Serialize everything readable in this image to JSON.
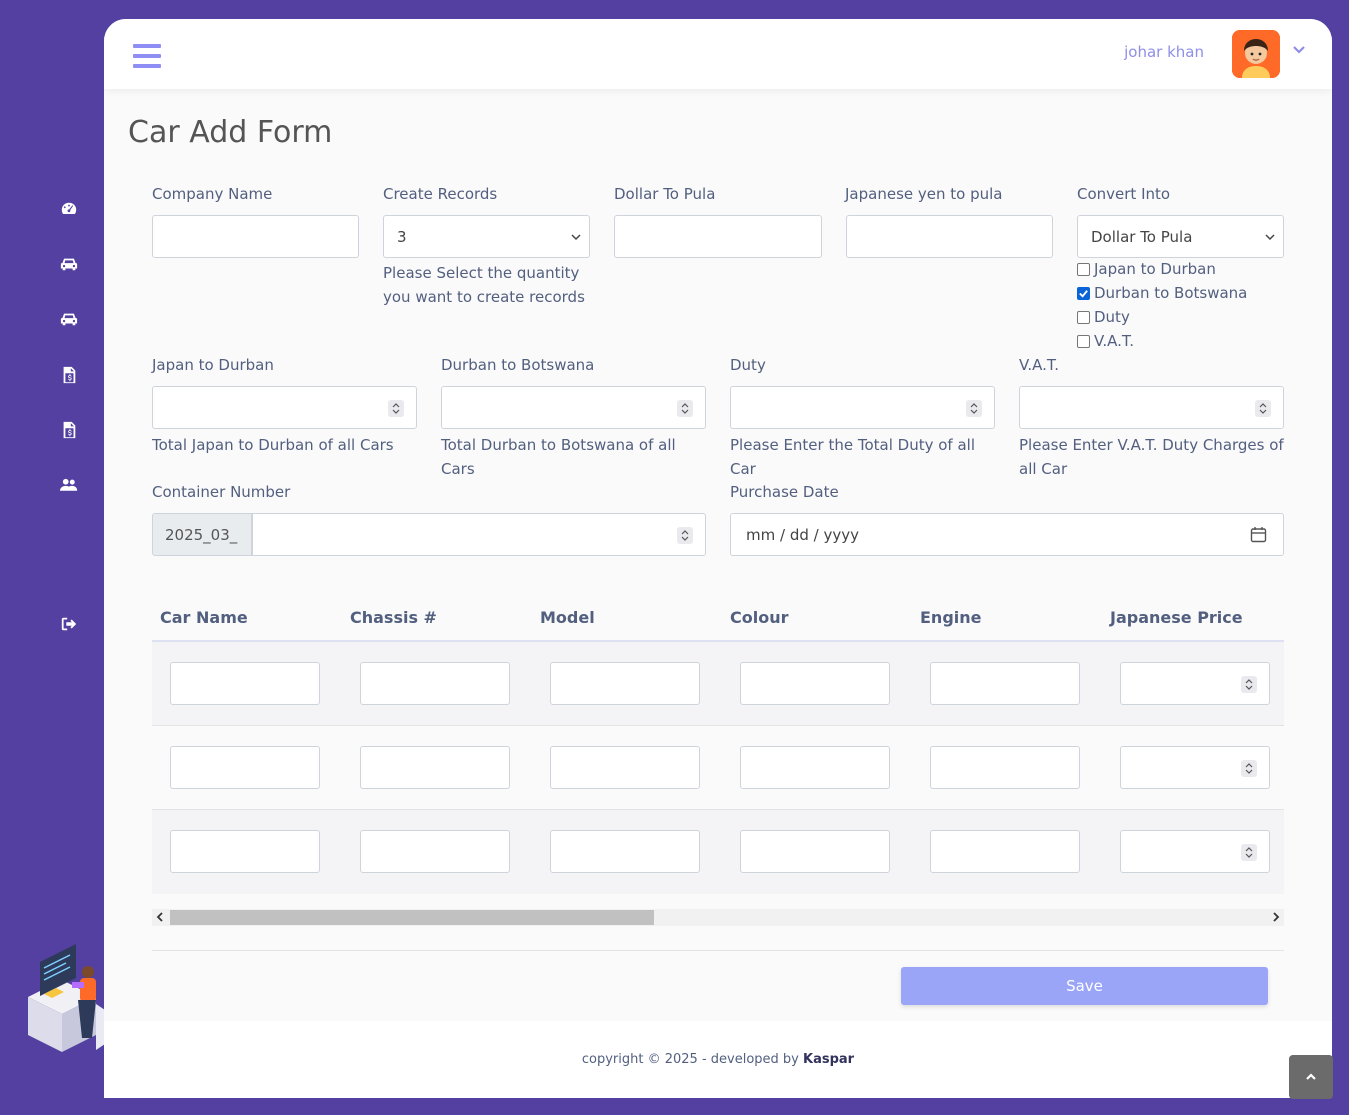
{
  "user": {
    "name": "johar khan"
  },
  "page_title": "Car Add Form",
  "sidebar": {
    "items": [
      {
        "icon": "dashboard-icon"
      },
      {
        "icon": "car-icon"
      },
      {
        "icon": "car-icon"
      },
      {
        "icon": "invoice-icon"
      },
      {
        "icon": "invoice-icon"
      },
      {
        "icon": "users-icon"
      },
      {
        "icon": "logout-icon"
      }
    ]
  },
  "form": {
    "company_name": {
      "label": "Company Name",
      "value": ""
    },
    "create_records": {
      "label": "Create Records",
      "value": "3",
      "help": "Please Select the quantity you want to create records"
    },
    "dollar_to_pula": {
      "label": "Dollar To Pula",
      "value": ""
    },
    "yen_to_pula": {
      "label": "Japanese yen to pula",
      "value": ""
    },
    "convert_into": {
      "label": "Convert Into",
      "value": "Dollar To Pula",
      "options": [
        {
          "label": "Japan to Durban",
          "checked": false
        },
        {
          "label": "Durban to Botswana",
          "checked": true
        },
        {
          "label": "Duty",
          "checked": false
        },
        {
          "label": "V.A.T.",
          "checked": false
        }
      ]
    },
    "japan_to_durban": {
      "label": "Japan to Durban",
      "value": "",
      "help": "Total Japan to Durban of all Cars"
    },
    "durban_to_botswana": {
      "label": "Durban to Botswana",
      "value": "",
      "help": "Total Durban to Botswana of all Cars"
    },
    "duty": {
      "label": "Duty",
      "value": "",
      "help": "Please Enter the Total Duty of all Car"
    },
    "vat": {
      "label": "V.A.T.",
      "value": "",
      "help": "Please Enter V.A.T. Duty Charges of all Car"
    },
    "container_number": {
      "label": "Container Number",
      "prefix": "2025_03_",
      "value": ""
    },
    "purchase_date": {
      "label": "Purchase Date",
      "placeholder": "mm / dd / yyyy"
    }
  },
  "table": {
    "columns": [
      "Car Name",
      "Chassis #",
      "Model",
      "Colour",
      "Engine",
      "Japanese Price"
    ],
    "rows": 3
  },
  "buttons": {
    "save": "Save"
  },
  "footer": {
    "text": "copyright © 2025 - developed by",
    "brand": "Kaspar"
  }
}
